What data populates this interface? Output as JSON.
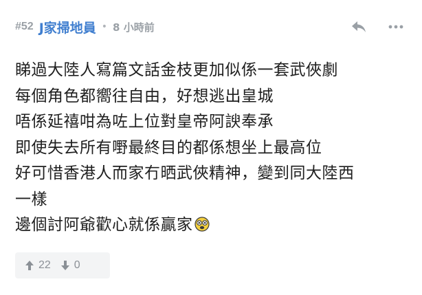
{
  "post": {
    "floor": "#52",
    "author": "J家掃地員",
    "separator": "•",
    "time": "8 小時前",
    "content_lines": [
      "睇過大陸人寫篇文話金枝更加似係一套武俠劇",
      "每個角色都嚮往自由，好想逃出皇城",
      "唔係延禧咁為咗上位對皇帝阿諛奉承",
      "即使失去所有嘢最終目的都係想坐上最高位",
      "好可惜香港人而家冇晒武俠精神，變到同大陸西",
      "一樣",
      "邊個討阿爺歡心就係贏家"
    ],
    "emoji_icon": "dizzy-face-emoji-icon",
    "actions": {
      "reply_icon": "reply-icon",
      "more_icon": "more-options-icon"
    },
    "votes": {
      "up": "22",
      "down": "0"
    }
  },
  "colors": {
    "author": "#3f7ecf",
    "meta": "#9aa0a6",
    "text": "#1f1f1f",
    "vote_bg": "#f3f4f5"
  }
}
